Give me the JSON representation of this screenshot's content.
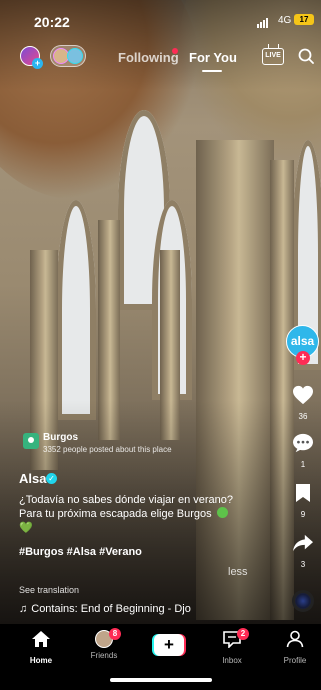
{
  "status_bar": {
    "time": "20:22",
    "network": "4G",
    "battery": "17"
  },
  "top_nav": {
    "tabs": [
      {
        "label": "Following",
        "has_dot": true
      },
      {
        "label": "For You",
        "active": true
      }
    ],
    "live_label": "LIVE",
    "icons": [
      "profile-add-icon",
      "friends-avatars-icon",
      "live-icon",
      "search-icon"
    ]
  },
  "actions": {
    "creator_label": "alsa",
    "likes": "36",
    "comments": "1",
    "saves": "9",
    "shares": "3"
  },
  "location": {
    "name": "Burgos",
    "subtitle": "3352 people posted about this place"
  },
  "post": {
    "author": "Alsa",
    "caption_line1": "¿Todavía no sabes dónde viajar en verano?",
    "caption_line2": "Para tu próxima escapada elige Burgos",
    "caption_heart": "💚",
    "hashtags": "#Burgos #Alsa #Verano",
    "less_label": "less",
    "see_translation": "See translation",
    "music_note": "♫",
    "music": "Contains: End of Beginning - Djo"
  },
  "bottom_nav": {
    "items": [
      {
        "label": "Home",
        "active": true
      },
      {
        "label": "Friends",
        "badge": "8"
      },
      {
        "label": "",
        "create": true
      },
      {
        "label": "Inbox",
        "badge": "2"
      },
      {
        "label": "Profile"
      }
    ]
  },
  "colors": {
    "accent_red": "#fe2c55",
    "accent_cyan": "#25f4ee",
    "creator_blue": "#2fb7ea",
    "location_green": "#36b37e"
  }
}
